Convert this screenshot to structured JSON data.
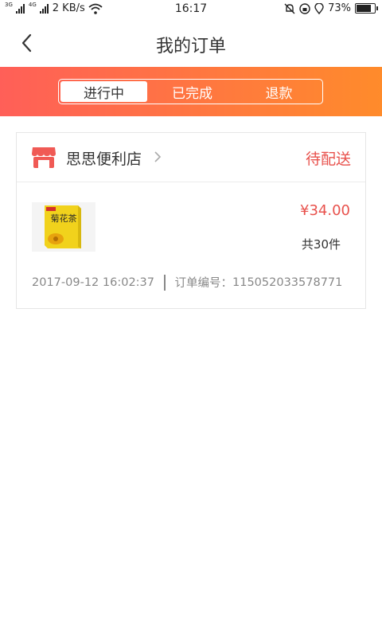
{
  "status_bar": {
    "net_1": "3G",
    "net_2": "4G",
    "speed": "2 KB/s",
    "time": "16:17",
    "battery": "73%",
    "battery_level": 0.73,
    "icons": [
      "signal-icon",
      "wifi-icon",
      "mute-icon",
      "rotation-lock-icon",
      "location-icon",
      "battery-icon"
    ]
  },
  "header": {
    "title": "我的订单",
    "back_icon": "back-arrow-icon"
  },
  "tabs": [
    {
      "label": "进行中",
      "active": true
    },
    {
      "label": "已完成",
      "active": false
    },
    {
      "label": "退款",
      "active": false
    }
  ],
  "order": {
    "store_name": "思思便利店",
    "store_icon": "store-icon",
    "status": "待配送",
    "price": "¥34.00",
    "quantity": "共30件",
    "date": "2017-09-12 16:02:37",
    "order_no_label": "订单编号：",
    "order_no": "115052033578771",
    "product_image_text": "菊花茶"
  },
  "colors": {
    "accent": "#e8514c",
    "band_start": "#ff5f58",
    "band_end": "#ff8b2b"
  }
}
